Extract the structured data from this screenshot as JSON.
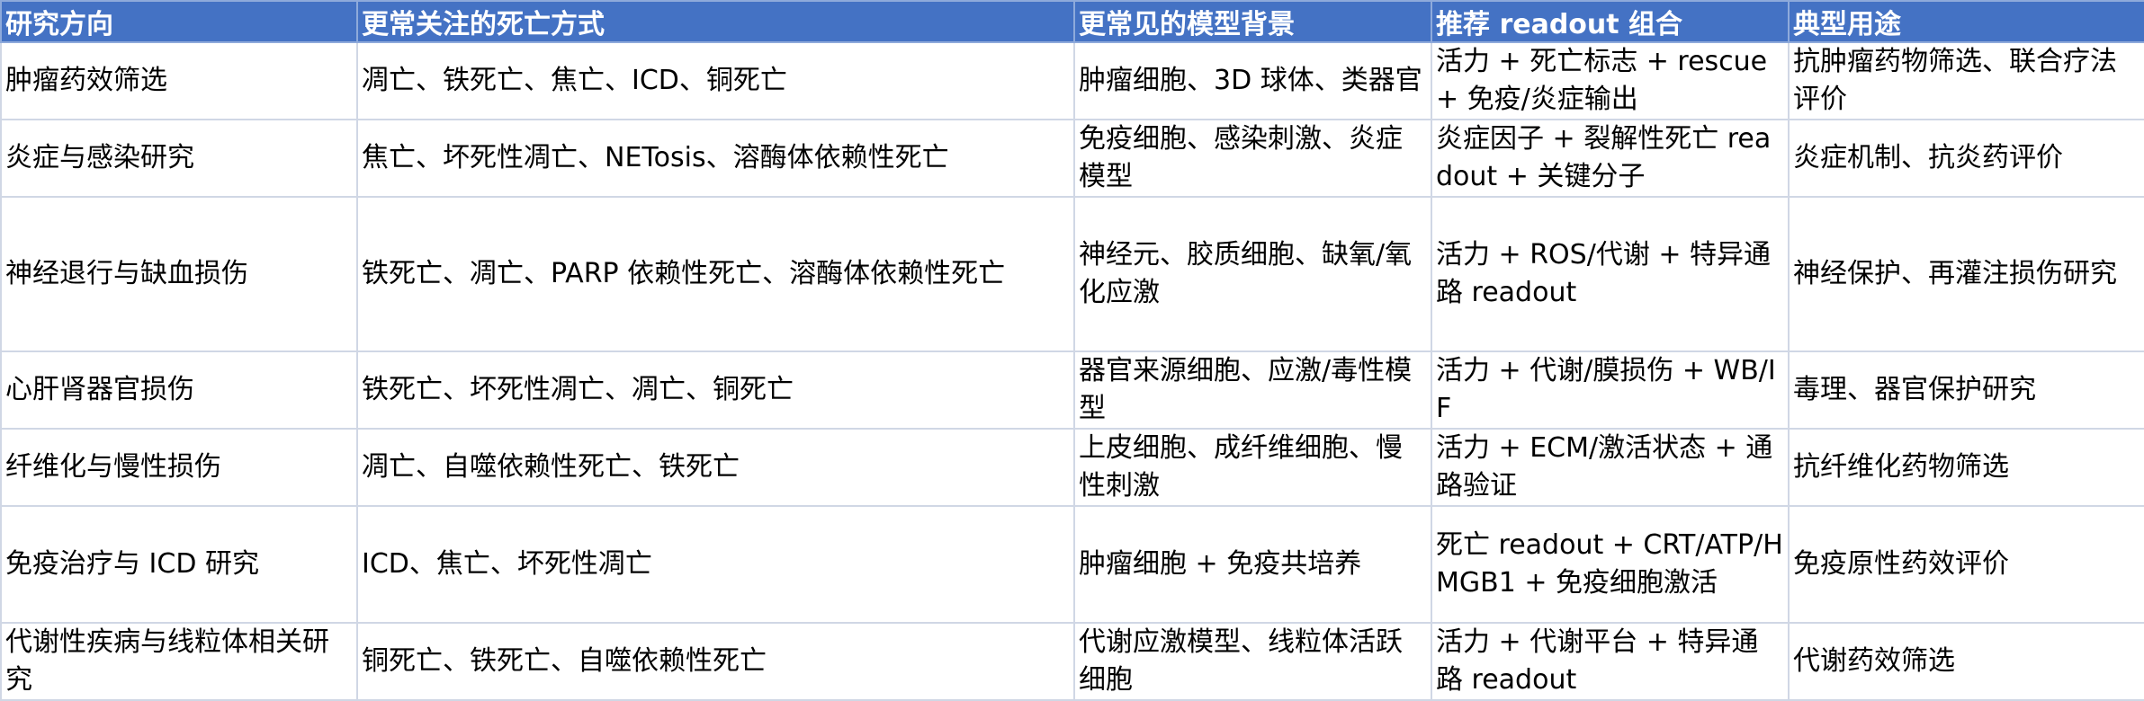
{
  "table": {
    "headers": [
      "研究方向",
      "更常关注的死亡方式",
      "更常见的模型背景",
      "推荐 readout 组合",
      "典型用途"
    ],
    "rows": [
      [
        "肿瘤药效筛选",
        "凋亡、铁死亡、焦亡、ICD、铜死亡",
        "肿瘤细胞、3D 球体、类器官",
        "活力 + 死亡标志 + rescue + 免疫/炎症输出",
        "抗肿瘤药物筛选、联合疗法评价"
      ],
      [
        "炎症与感染研究",
        "焦亡、坏死性凋亡、NETosis、溶酶体依赖性死亡",
        "免疫细胞、感染刺激、炎症模型",
        "炎症因子 + 裂解性死亡 readout + 关键分子",
        "炎症机制、抗炎药评价"
      ],
      [
        "神经退行与缺血损伤",
        "铁死亡、凋亡、PARP 依赖性死亡、溶酶体依赖性死亡",
        "神经元、胶质细胞、缺氧/氧化应激",
        "活力 + ROS/代谢 + 特异通路 readout",
        "神经保护、再灌注损伤研究"
      ],
      [
        "心肝肾器官损伤",
        "铁死亡、坏死性凋亡、凋亡、铜死亡",
        "器官来源细胞、应激/毒性模型",
        "活力 + 代谢/膜损伤 + WB/IF",
        "毒理、器官保护研究"
      ],
      [
        "纤维化与慢性损伤",
        "凋亡、自噬依赖性死亡、铁死亡",
        "上皮细胞、成纤维细胞、慢性刺激",
        "活力 + ECM/激活状态 + 通路验证",
        "抗纤维化药物筛选"
      ],
      [
        "免疫治疗与 ICD 研究",
        "ICD、焦亡、坏死性凋亡",
        "肿瘤细胞 + 免疫共培养",
        "死亡 readout + CRT/ATP/HMGB1 + 免疫细胞激活",
        "免疫原性药效评价"
      ],
      [
        "代谢性疾病与线粒体相关研究",
        "铜死亡、铁死亡、自噬依赖性死亡",
        "代谢应激模型、线粒体活跃细胞",
        "活力 + 代谢平台 + 特异通路 readout",
        "代谢药效筛选"
      ]
    ]
  },
  "colors": {
    "header_bg": "#4472c4",
    "header_text": "#ffffff",
    "grid_line": "#d0d7e5"
  }
}
